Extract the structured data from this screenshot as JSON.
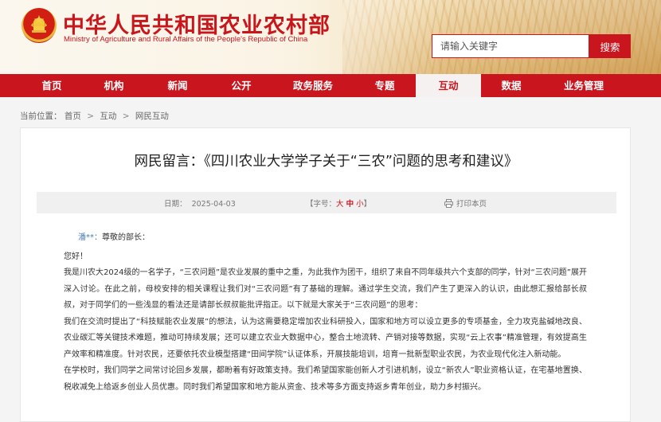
{
  "header": {
    "site_title": "中华人民共和国农业农村部",
    "site_subtitle": "Ministry of Agriculture and Rural Affairs of the People's Republic of China",
    "search_placeholder": "请输入关键字",
    "search_button": "搜索",
    "emblem_icon": "national-emblem",
    "accent_color": "#c9151e"
  },
  "nav": {
    "items": [
      {
        "label": "首页"
      },
      {
        "label": "机构"
      },
      {
        "label": "新闻"
      },
      {
        "label": "公开"
      },
      {
        "label": "政务服务"
      },
      {
        "label": "专题"
      },
      {
        "label": "互动"
      },
      {
        "label": "数据"
      },
      {
        "label": "业务管理"
      }
    ],
    "active": "互动"
  },
  "breadcrumb": {
    "prefix": "当前位置：",
    "items": [
      "首页",
      "互动",
      "网民互动"
    ],
    "separator": ">"
  },
  "article": {
    "title": "网民留言：《四川农业大学学子关于“三农”问题的思考和建议》",
    "date_label": "日期：",
    "date": "2025-04-03",
    "fontsize_label": "【字号：",
    "fontsize_large": "大",
    "fontsize_medium": "中",
    "fontsize_small": "小",
    "fontsize_close": "】",
    "print_label": "打印本页",
    "print_icon": "printer-icon",
    "author": "潘**：",
    "salutation": "尊敬的部长：",
    "greeting": "您好！",
    "paragraphs": [
      "我是川农大2024级的一名学子，“三农问题”是农业发展的重中之重，为此我作为团干，组织了来自不同年级共六个支部的同学，针对“三农问题”展开深入讨论。在此之前，母校安排的相关课程让我们对“三农问题”有了基础的理解。通过学生交流，我们产生了更深入的认识，由此想汇报给部长叔叔，对于同学们的一些浅显的看法还是请部长叔叔能批评指正。以下就是大家关于“三农问题”的思考：",
      "我们在交流时提出了“科技赋能农业发展”的想法，认为这需要稳定增加农业科研投入，国家和地方可以设立更多的专项基金，全力攻克盐碱地改良、农业碳汇等关键技术难题，推动可持续发展；还可以建立农业大数据中心，整合土地流转、产销对接等数据，实现“云上农事”精准管理，有效提高生产效率和精准度。针对农民，还要依托农业模型搭建“田间学院”认证体系，开展技能培训，培育一批新型职业农民，为农业现代化注入新动能。",
      "在学校时，我们同学之间常讨论回乡发展，都盼着有好政策支持。我们希望国家能创新人才引进机制，设立“新农人”职业资格认证，在宅基地置换、税收减免上给返乡创业人员优惠。同时我们希望国家和地方能从资金、技术等多方面支持返乡青年创业，助力乡村振兴。"
    ]
  }
}
